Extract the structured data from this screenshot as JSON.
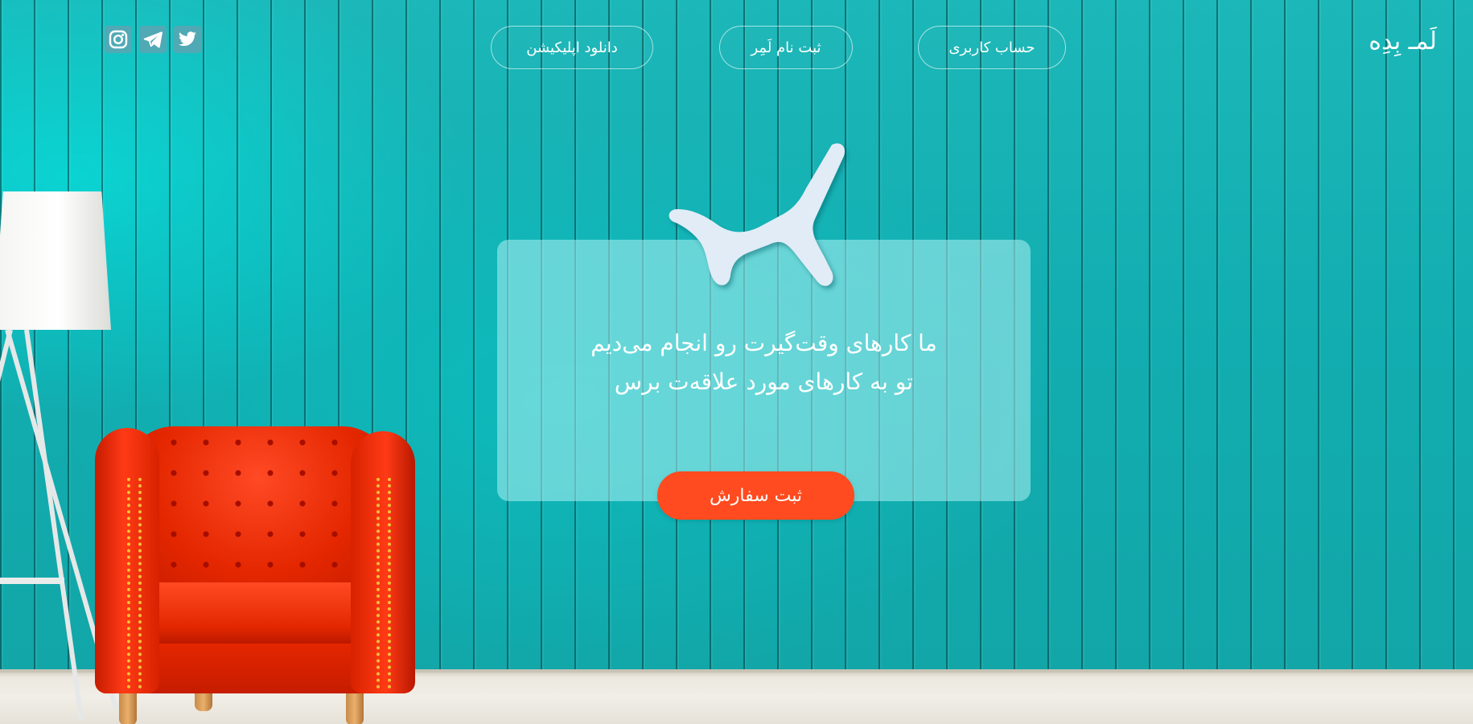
{
  "header": {
    "logo": "لَمـ بِدِه",
    "nav": {
      "account": "حساب کاربری",
      "register_lamer": "ثبت نام لَمِر",
      "download_app": "دانلود اپلیکیشن"
    },
    "social_icons": [
      "instagram-icon",
      "telegram-icon",
      "twitter-icon"
    ]
  },
  "hero": {
    "line1": "ما کارهای وقت‌گیرت رو انجام می‌دیم",
    "line2": "تو به کارهای مورد علاقه‌ت برس",
    "cta_label": "ثبت سفارش"
  },
  "colors": {
    "wall": "#12aeb1",
    "cta": "#ff4b1f",
    "card": "rgba(175,240,243,0.55)",
    "text": "#ffffff"
  }
}
